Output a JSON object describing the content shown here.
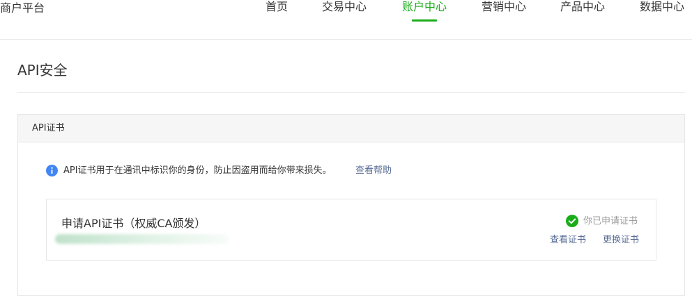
{
  "header": {
    "brand": "商户平台",
    "nav": [
      {
        "label": "首页",
        "active": false
      },
      {
        "label": "交易中心",
        "active": false
      },
      {
        "label": "账户中心",
        "active": true
      },
      {
        "label": "营销中心",
        "active": false
      },
      {
        "label": "产品中心",
        "active": false
      },
      {
        "label": "数据中心",
        "active": false
      }
    ]
  },
  "page": {
    "title": "API安全"
  },
  "panel": {
    "title": "API证书",
    "notice": {
      "icon": "info-icon",
      "text": "API证书用于在通讯中标识你的身份，防止因盗用而给你带来损失。",
      "link": "查看帮助"
    },
    "cert": {
      "title": "申请API证书（权威CA颁发）",
      "status_icon": "check-circle-icon",
      "status": "你已申请证书",
      "view_link": "查看证书",
      "replace_link": "更换证书"
    }
  },
  "colors": {
    "accent": "#1aad19",
    "link": "#576b95",
    "info": "#4285f4",
    "muted": "#9a9a9a"
  }
}
